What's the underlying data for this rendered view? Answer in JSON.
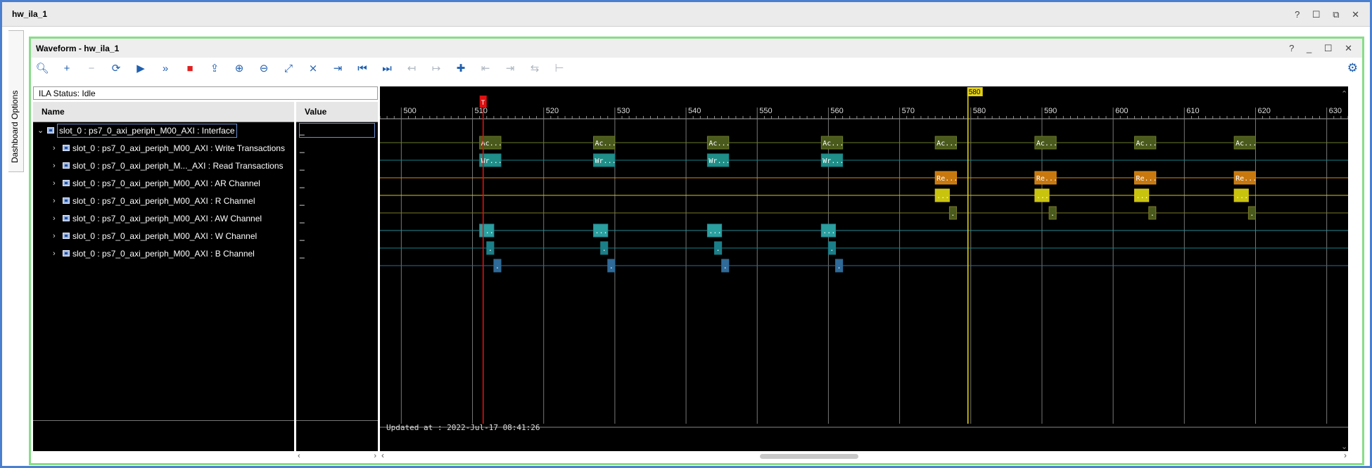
{
  "window": {
    "title": "hw_ila_1",
    "controls": "? ☐ ⧉ ✕"
  },
  "side_tab": {
    "label": "Dashboard Options"
  },
  "panel": {
    "title": "Waveform - hw_ila_1",
    "controls": "? _ ☐ ✕"
  },
  "toolbar": {
    "icons": [
      "search-icon",
      "add-icon",
      "remove-icon",
      "refresh-icon",
      "run-trigger-icon",
      "run-immediate-icon",
      "stop-icon",
      "export-icon",
      "zoom-in-icon",
      "zoom-out-icon",
      "zoom-fit-icon",
      "swap-icon",
      "go-to-cursor-icon",
      "go-to-start-icon",
      "go-to-end-icon",
      "prev-transition-icon",
      "next-transition-icon",
      "add-marker-icon",
      "prev-marker-icon",
      "next-marker-icon",
      "swap-cursors-icon",
      "snap-icon",
      "settings-icon"
    ]
  },
  "ila_status": "ILA Status:  Idle",
  "columns": {
    "name": "Name",
    "value": "Value"
  },
  "signals": [
    {
      "label": "slot_0 : ps7_0_axi_periph_M00_AXI : Interface",
      "value": "_",
      "expanded": true
    },
    {
      "label": "slot_0 : ps7_0_axi_periph_M00_AXI : Write Transactions",
      "value": "_"
    },
    {
      "label": "slot_0 : ps7_0_axi_periph_M..._AXI : Read Transactions",
      "value": "_"
    },
    {
      "label": "slot_0 : ps7_0_axi_periph_M00_AXI : AR Channel",
      "value": "_"
    },
    {
      "label": "slot_0 : ps7_0_axi_periph_M00_AXI : R Channel",
      "value": "_"
    },
    {
      "label": "slot_0 : ps7_0_axi_periph_M00_AXI : AW Channel",
      "value": "_"
    },
    {
      "label": "slot_0 : ps7_0_axi_periph_M00_AXI : W Channel",
      "value": "_"
    },
    {
      "label": "slot_0 : ps7_0_axi_periph_M00_AXI : B Channel",
      "value": "_"
    }
  ],
  "waveform": {
    "ticks": [
      "500",
      "510",
      "520",
      "530",
      "540",
      "550",
      "560",
      "570",
      "580",
      "590",
      "600",
      "610",
      "620",
      "630"
    ],
    "tick_values": [
      500,
      510,
      520,
      530,
      540,
      550,
      560,
      570,
      580,
      590,
      600,
      610,
      620,
      630
    ],
    "x_range": [
      497,
      633
    ],
    "trigger_at": 511.5,
    "trigger_label": "T",
    "cursor_at": 579.6,
    "cursor_label": "580",
    "updated": "Updated at : 2022-Jul-17 08:41:26",
    "colors": {
      "trigger": "#dd1111",
      "cursor": "#e3d116",
      "write": "#2a9a90",
      "read": "#d88a1a",
      "interface": "#4a5a1c"
    },
    "lanes": [
      {
        "color": "#6a7a2a",
        "fill": "#4a5a1c",
        "text": "Ac...",
        "starts": [
          511,
          527,
          543,
          559,
          575,
          589,
          603,
          617
        ],
        "width": 3.0
      },
      {
        "color": "#1a7f88",
        "fill": "#1f8f88",
        "text": "Wr...",
        "starts": [
          511,
          527,
          543,
          559
        ],
        "width": 3.0
      },
      {
        "color": "#d88a1a",
        "fill": "#c8780e",
        "text": "Re...",
        "starts": [
          575,
          589,
          603,
          617
        ],
        "width": 3.0
      },
      {
        "color": "#d8c41a",
        "fill": "#c8c40e",
        "text": "...",
        "starts": [
          575,
          589,
          603,
          617
        ],
        "width": 2.0
      },
      {
        "color": "#7a7a2a",
        "fill": "#4a5a1c",
        "text": ".",
        "starts": [
          577,
          591,
          605,
          619
        ],
        "width": 1.0
      },
      {
        "color": "#2a8a98",
        "fill": "#2aa0a0",
        "text": "...",
        "starts": [
          511,
          527,
          543,
          559
        ],
        "width": 2.0
      },
      {
        "color": "#1a7f88",
        "fill": "#1a7f88",
        "text": ".",
        "starts": [
          512,
          528,
          544,
          560
        ],
        "width": 1.0
      },
      {
        "color": "#2f6a98",
        "fill": "#2f6a98",
        "text": ".",
        "starts": [
          513,
          529,
          545,
          561
        ],
        "width": 1.0
      }
    ]
  }
}
